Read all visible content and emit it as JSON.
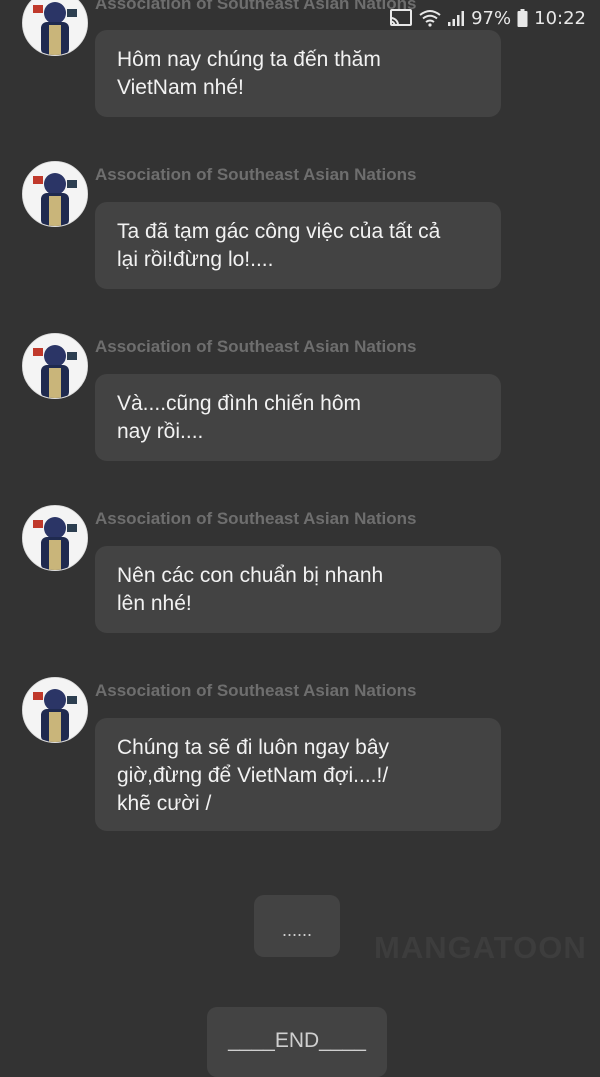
{
  "status_bar": {
    "battery": "97%",
    "time": "10:22"
  },
  "messages": [
    {
      "sender": "Association of Southeast Asian Nations",
      "lines": [
        "Hôm nay chúng ta đến thăm",
        "VietNam nhé!"
      ]
    },
    {
      "sender": "Association of Southeast Asian Nations",
      "lines": [
        "Ta đã tạm gác công việc của tất cả",
        "lại rồi!đừng lo!...."
      ]
    },
    {
      "sender": "Association of Southeast Asian Nations",
      "lines": [
        "Và....cũng đình chiến hôm",
        "nay rồi...."
      ]
    },
    {
      "sender": "Association of Southeast Asian Nations",
      "lines": [
        "Nên các con chuẩn bị nhanh",
        "lên nhé!"
      ]
    },
    {
      "sender": "Association of Southeast Asian Nations",
      "lines": [
        "Chúng ta sẽ đi luôn ngay bây",
        "giờ,đừng để VietNam đợi....!/",
        "khẽ cười /"
      ]
    }
  ],
  "ellipsis_label": "......",
  "watermark": "MANGATOON",
  "end_label": "____END____"
}
